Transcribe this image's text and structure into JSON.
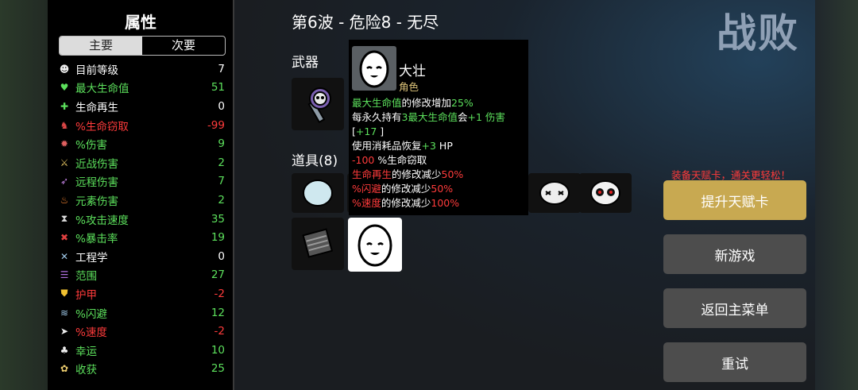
{
  "stats": {
    "title": "属性",
    "tabs": [
      "主要",
      "次要"
    ],
    "rows": [
      {
        "icon": "level-icon",
        "label": "目前等级",
        "value": "7",
        "color": "#ffffff"
      },
      {
        "icon": "heart-icon",
        "label": "最大生命值",
        "value": "51",
        "color": "#5ce05c"
      },
      {
        "icon": "regen-icon",
        "label": "生命再生",
        "value": "0",
        "color": "#ffffff"
      },
      {
        "icon": "lifesteal-icon",
        "label": "%生命窃取",
        "value": "-99",
        "color": "#ff3b3b"
      },
      {
        "icon": "damage-icon",
        "label": "%伤害",
        "value": "9",
        "color": "#5ce05c"
      },
      {
        "icon": "melee-icon",
        "label": "近战伤害",
        "value": "2",
        "color": "#5ce05c"
      },
      {
        "icon": "ranged-icon",
        "label": "远程伤害",
        "value": "7",
        "color": "#5ce05c"
      },
      {
        "icon": "elemental-icon",
        "label": "元素伤害",
        "value": "2",
        "color": "#5ce05c"
      },
      {
        "icon": "hourglass-icon",
        "label": "%攻击速度",
        "value": "35",
        "color": "#5ce05c"
      },
      {
        "icon": "crit-icon",
        "label": "%暴击率",
        "value": "19",
        "color": "#5ce05c"
      },
      {
        "icon": "wrench-icon",
        "label": "工程学",
        "value": "0",
        "color": "#ffffff"
      },
      {
        "icon": "range-icon",
        "label": "范围",
        "value": "27",
        "color": "#5ce05c"
      },
      {
        "icon": "armor-icon",
        "label": "护甲",
        "value": "-2",
        "color": "#ff3b3b"
      },
      {
        "icon": "dodge-icon",
        "label": "%闪避",
        "value": "12",
        "color": "#5ce05c"
      },
      {
        "icon": "speed-icon",
        "label": "%速度",
        "value": "-2",
        "color": "#ff3b3b"
      },
      {
        "icon": "luck-icon",
        "label": "幸运",
        "value": "10",
        "color": "#5ce05c"
      },
      {
        "icon": "harvest-icon",
        "label": "收获",
        "value": "25",
        "color": "#5ce05c"
      }
    ]
  },
  "header": {
    "wave_title": "第6波 - 危险8 - 无尽",
    "defeat": "战败"
  },
  "sections": {
    "weapons": "武器",
    "items": "道具(8)"
  },
  "tooltip": {
    "name": "大壮",
    "type": "角色",
    "lines": [
      [
        {
          "t": "最大生命值",
          "c": "g"
        },
        {
          "t": "的修改增加",
          "c": ""
        },
        {
          "t": "25%",
          "c": "g"
        }
      ],
      [
        {
          "t": "每永久持有",
          "c": ""
        },
        {
          "t": "3",
          "c": "g"
        },
        {
          "t": "最大生命值",
          "c": "g"
        },
        {
          "t": "会",
          "c": ""
        },
        {
          "t": "+1",
          "c": "g"
        },
        {
          "t": " 伤害",
          "c": "g"
        }
      ],
      [
        {
          "t": "[",
          "c": ""
        },
        {
          "t": "+17",
          "c": "g"
        },
        {
          "t": " ]",
          "c": ""
        }
      ],
      [
        {
          "t": "使用消耗品恢复",
          "c": ""
        },
        {
          "t": "+3",
          "c": "g"
        },
        {
          "t": " HP",
          "c": ""
        }
      ],
      [
        {
          "t": "-100",
          "c": "r"
        },
        {
          "t": " %生命窃取",
          "c": ""
        }
      ],
      [
        {
          "t": "生命再生",
          "c": "r"
        },
        {
          "t": "的修改减少",
          "c": ""
        },
        {
          "t": "50%",
          "c": "r"
        }
      ],
      [
        {
          "t": "%闪避",
          "c": "r"
        },
        {
          "t": "的修改减少",
          "c": ""
        },
        {
          "t": "50%",
          "c": "r"
        }
      ],
      [
        {
          "t": "%速度",
          "c": "r"
        },
        {
          "t": "的修改减少",
          "c": ""
        },
        {
          "t": "100%",
          "c": "r"
        }
      ]
    ]
  },
  "actions": {
    "hint": "装备天赋卡，通关更轻松！",
    "upgrade": "提升天赋卡",
    "new_game": "新游戏",
    "main_menu": "返回主菜单",
    "retry": "重试"
  }
}
